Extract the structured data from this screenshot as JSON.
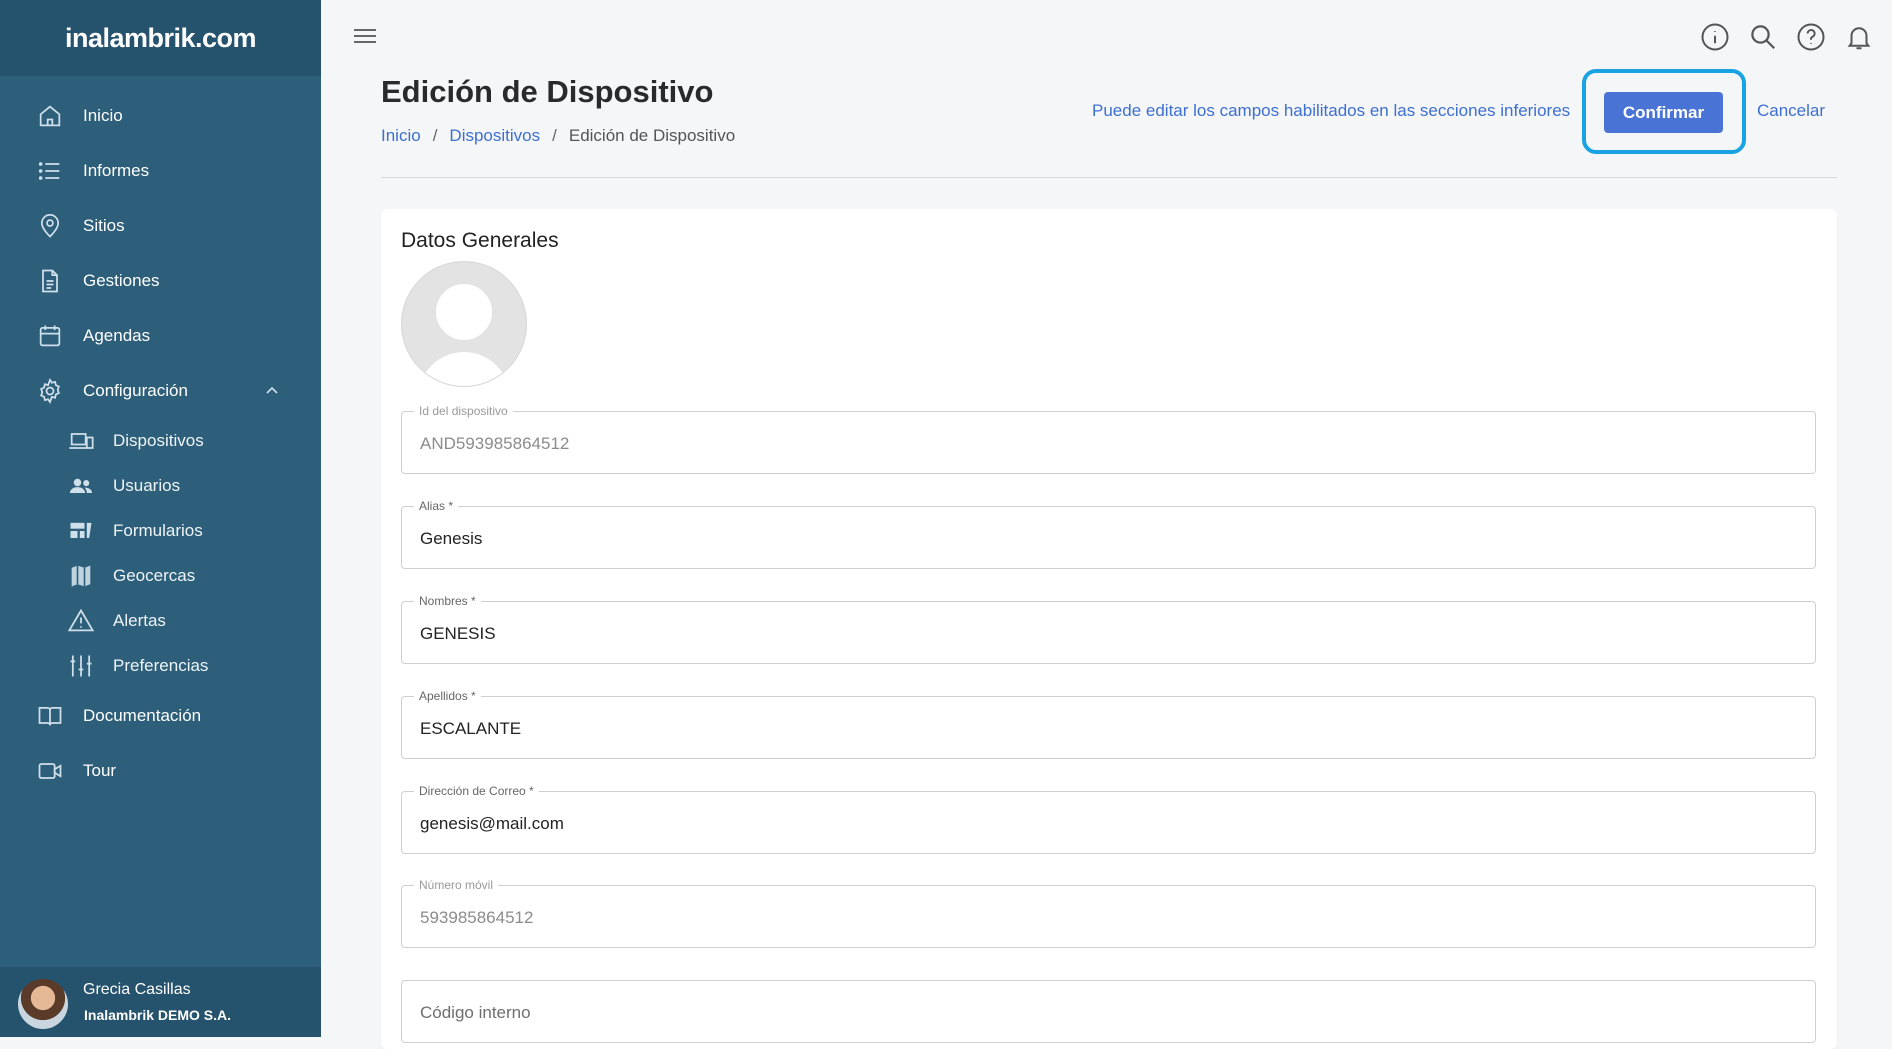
{
  "sidebar": {
    "logo": "inalambrik.com",
    "items": [
      {
        "label": "Inicio",
        "icon": "home-icon"
      },
      {
        "label": "Informes",
        "icon": "list-icon"
      },
      {
        "label": "Sitios",
        "icon": "map-pin-icon"
      },
      {
        "label": "Gestiones",
        "icon": "document-icon"
      },
      {
        "label": "Agendas",
        "icon": "calendar-icon"
      },
      {
        "label": "Configuración",
        "icon": "gear-icon",
        "expanded": true
      }
    ],
    "sub_items": [
      {
        "label": "Dispositivos",
        "icon": "devices-icon"
      },
      {
        "label": "Usuarios",
        "icon": "users-icon"
      },
      {
        "label": "Formularios",
        "icon": "forms-icon"
      },
      {
        "label": "Geocercas",
        "icon": "map-icon"
      },
      {
        "label": "Alertas",
        "icon": "warning-icon"
      },
      {
        "label": "Preferencias",
        "icon": "sliders-icon"
      }
    ],
    "bottom_items": [
      {
        "label": "Documentación",
        "icon": "book-icon"
      },
      {
        "label": "Tour",
        "icon": "video-icon"
      }
    ],
    "user": {
      "name": "Grecia Casillas",
      "org": "Inalambrik DEMO S.A."
    }
  },
  "topbar": {
    "icons": [
      "info-icon",
      "search-icon",
      "help-icon",
      "bell-icon"
    ]
  },
  "header": {
    "title": "Edición de Dispositivo",
    "breadcrumb": [
      "Inicio",
      "Dispositivos",
      "Edición de Dispositivo"
    ],
    "hint": "Puede editar los campos habilitados en las secciones inferiores",
    "confirm_label": "Confirmar",
    "cancel_label": "Cancelar"
  },
  "colors": {
    "sidebar": "#2d5e7a",
    "accent": "#4a73d6",
    "highlight": "#1aa3e3"
  },
  "card": {
    "title": "Datos Generales",
    "fields": [
      {
        "label": "Id del dispositivo",
        "value": "AND593985864512",
        "disabled": true
      },
      {
        "label": "Alias *",
        "value": "Genesis",
        "disabled": false
      },
      {
        "label": "Nombres *",
        "value": "GENESIS",
        "disabled": false
      },
      {
        "label": "Apellidos *",
        "value": "ESCALANTE",
        "disabled": false
      },
      {
        "label": "Dirección de Correo *",
        "value": "genesis@mail.com",
        "disabled": false
      },
      {
        "label": "Número móvil",
        "value": "593985864512",
        "disabled": true
      },
      {
        "label": "",
        "placeholder": "Código interno",
        "value": "",
        "disabled": false
      }
    ]
  }
}
